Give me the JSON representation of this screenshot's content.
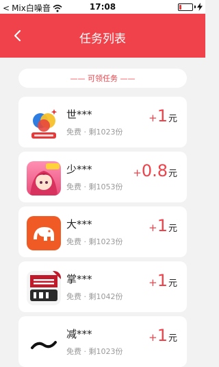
{
  "status_bar": {
    "back_glyph": "<",
    "carrier": "Mix白噪音",
    "time": "17:08",
    "battery_level": 0.15
  },
  "header": {
    "title": "任务列表"
  },
  "section_pill": {
    "label": "—— 可领任务 ——"
  },
  "accent_color": "#f0424a",
  "tasks": [
    {
      "name": "世***",
      "fee": "免费",
      "remaining": "剩1023份",
      "plus": "+",
      "amount": "1",
      "unit": "元",
      "icon": "map-globe-icon"
    },
    {
      "name": "少***",
      "fee": "免费",
      "remaining": "剩1053份",
      "plus": "+",
      "amount": "0.8",
      "unit": "元",
      "icon": "anime-game-icon"
    },
    {
      "name": "大***",
      "fee": "免费",
      "remaining": "剩1023份",
      "plus": "+",
      "amount": "1",
      "unit": "元",
      "icon": "elephant-icon"
    },
    {
      "name": "掌***",
      "fee": "免费",
      "remaining": "剩1042份",
      "plus": "+",
      "amount": "1",
      "unit": "元",
      "icon": "zhangmen-1v1-icon"
    },
    {
      "name": "减***",
      "fee": "免费",
      "remaining": "剩1023份",
      "plus": "+",
      "amount": "1",
      "unit": "元",
      "icon": "tilde-logo-icon"
    }
  ]
}
